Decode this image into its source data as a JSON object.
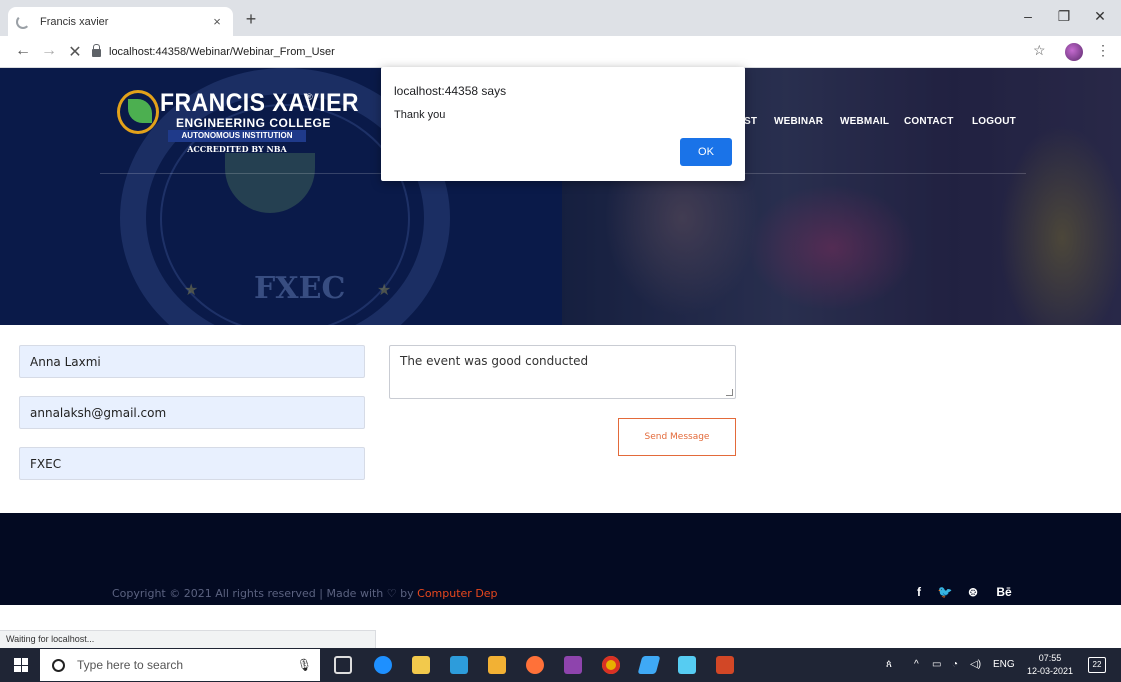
{
  "browser": {
    "tab_title": "Francis xavier",
    "tab_close": "×",
    "new_tab": "+",
    "url": "localhost:44358/Webinar/Webinar_From_User",
    "status": "Waiting for localhost...",
    "icons": [
      "loading-icon",
      "back-icon",
      "forward-icon",
      "stop-icon",
      "lock-icon",
      "star-icon",
      "profile-avatar",
      "menu-icon"
    ]
  },
  "window_controls": {
    "minimize": "–",
    "restore": "❐",
    "close": "✕"
  },
  "header": {
    "logo_title": "FRANCIS XAVIER",
    "logo_registered": "®",
    "logo_subtitle": "ENGINEERING COLLEGE",
    "logo_autonomous": "AUTONOMOUS INSTITUTION",
    "logo_accredited": "ACCREDITED BY NBA",
    "seal_text": "FXEC",
    "nav": [
      {
        "label": "ST"
      },
      {
        "label": "WEBINAR"
      },
      {
        "label": "WEBMAIL"
      },
      {
        "label": "CONTACT"
      },
      {
        "label": "LOGOUT"
      }
    ]
  },
  "form": {
    "name_value": "Anna Laxmi",
    "email_value": "annalaksh@gmail.com",
    "college_value": "FXEC",
    "message_value": "The event was good conducted",
    "send_label": "Send Message"
  },
  "footer": {
    "copyright": "Copyright © 2021 All rights reserved | Made with ♡ by ",
    "dep": "Computer Dep",
    "social": [
      "f",
      "🐦",
      "⊛",
      "Bē"
    ]
  },
  "dialog": {
    "title": "localhost:44358 says",
    "message": "Thank you",
    "ok_label": "OK"
  },
  "taskbar": {
    "search_placeholder": "Type here to search",
    "tray_lang": "ENG",
    "time": "07:55",
    "date": "12-03-2021",
    "notifications": "22"
  },
  "colors": {
    "hero_bg": "#0a1a49",
    "footer_bg": "#030a22",
    "accent_orange": "#e36a3a",
    "dialog_button": "#1a73e8",
    "field_bg": "#e8f0fe"
  }
}
